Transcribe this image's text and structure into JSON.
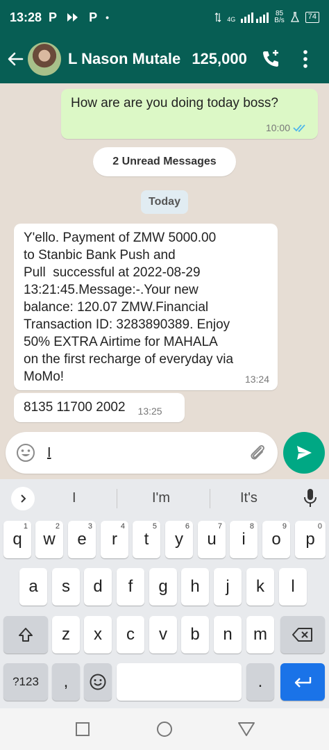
{
  "status_bar": {
    "time": "13:28",
    "icons": [
      "P",
      "P",
      "•"
    ],
    "network": "4G",
    "speed_top": "85",
    "speed_bottom": "B/s",
    "battery": "74"
  },
  "header": {
    "contact_name": "L Nason Mutale",
    "contact_balance": "125,000"
  },
  "chat": {
    "outgoing": [
      {
        "text": "How are are you doing today boss?",
        "time": "10:00"
      }
    ],
    "unread_label": "2 Unread Messages",
    "date_chip": "Today",
    "incoming": [
      {
        "lines": [
          "Y'ello. Payment of ZMW 5000.00",
          "to Stanbic Bank Push and",
          "Pull  successful at 2022-08-29",
          "13:21:45.Message:-.Your new",
          "balance: 120.07 ZMW.Financial",
          "Transaction ID: 3283890389. Enjoy",
          "50% EXTRA Airtime for MAHALA",
          "on the first recharge of everyday via",
          "MoMo!"
        ],
        "time": "13:24"
      },
      {
        "text": "8135 11700 2002",
        "time": "13:25"
      }
    ]
  },
  "composer": {
    "value": "I"
  },
  "keyboard": {
    "suggestions": [
      "I",
      "I'm",
      "It's"
    ],
    "row1": [
      {
        "k": "q",
        "h": "1"
      },
      {
        "k": "w",
        "h": "2"
      },
      {
        "k": "e",
        "h": "3"
      },
      {
        "k": "r",
        "h": "4"
      },
      {
        "k": "t",
        "h": "5"
      },
      {
        "k": "y",
        "h": "6"
      },
      {
        "k": "u",
        "h": "7"
      },
      {
        "k": "i",
        "h": "8"
      },
      {
        "k": "o",
        "h": "9"
      },
      {
        "k": "p",
        "h": "0"
      }
    ],
    "row2": [
      "a",
      "s",
      "d",
      "f",
      "g",
      "h",
      "j",
      "k",
      "l"
    ],
    "row3": [
      "z",
      "x",
      "c",
      "v",
      "b",
      "n",
      "m"
    ],
    "symbols_label": "?123",
    "comma": ",",
    "period": "."
  },
  "colors": {
    "header": "#075e54",
    "outgoing_bubble": "#dcf8c6",
    "send_button": "#00a884",
    "enter_key": "#1a73e8"
  }
}
